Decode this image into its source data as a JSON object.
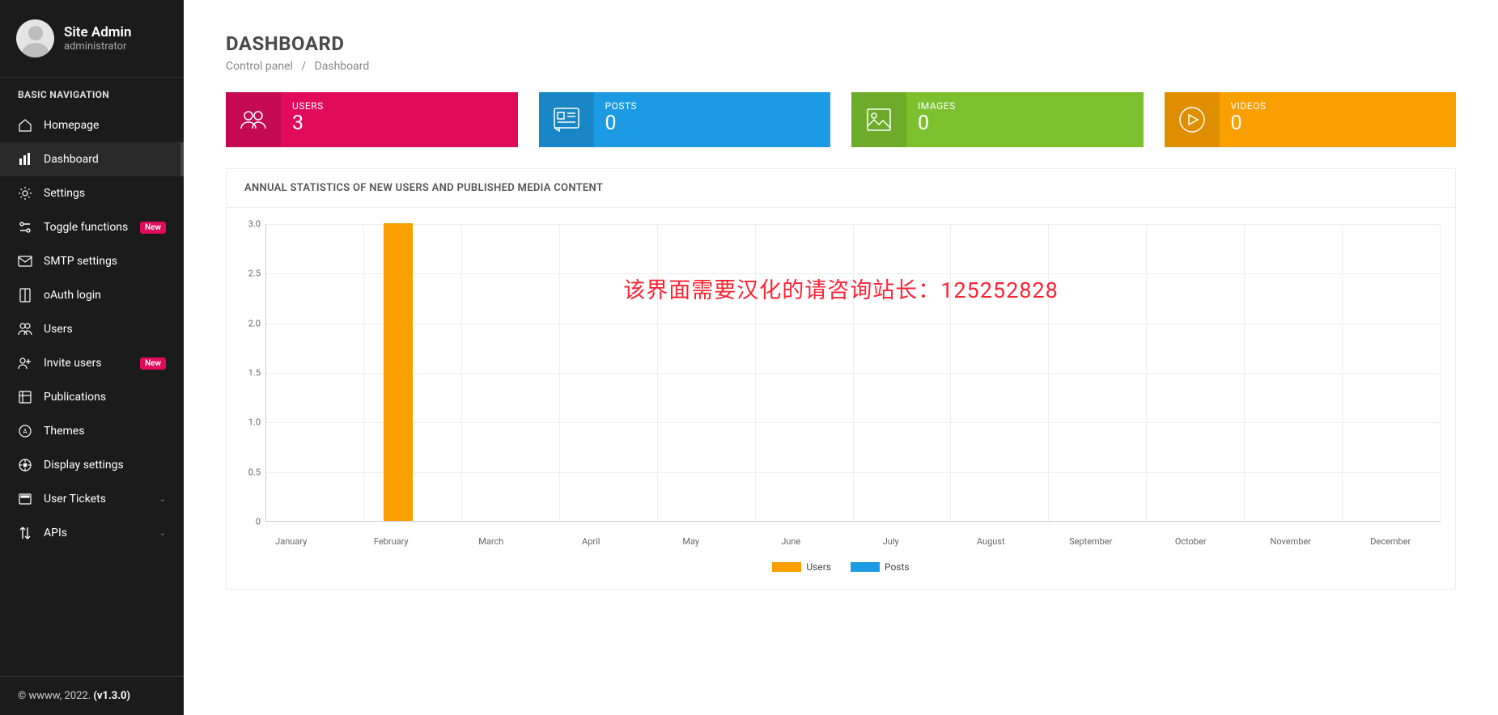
{
  "profile": {
    "name": "Site Admin",
    "role": "administrator"
  },
  "nav": {
    "heading": "BASIC NAVIGATION",
    "items": [
      {
        "label": "Homepage"
      },
      {
        "label": "Dashboard",
        "active": true
      },
      {
        "label": "Settings"
      },
      {
        "label": "Toggle functions",
        "badge": "New"
      },
      {
        "label": "SMTP settings"
      },
      {
        "label": "oAuth login"
      },
      {
        "label": "Users"
      },
      {
        "label": "Invite users",
        "badge": "New"
      },
      {
        "label": "Publications"
      },
      {
        "label": "Themes"
      },
      {
        "label": "Display settings"
      },
      {
        "label": "User Tickets",
        "expandable": true
      },
      {
        "label": "APIs",
        "expandable": true
      }
    ]
  },
  "footer": {
    "copyright": "© wwww, 2022. ",
    "version": "(v1.3.0)"
  },
  "page": {
    "title": "DASHBOARD",
    "crumb1": "Control panel",
    "sep": "/",
    "crumb2": "Dashboard"
  },
  "stats": {
    "users": {
      "label": "USERS",
      "value": "3"
    },
    "posts": {
      "label": "POSTS",
      "value": "0"
    },
    "images": {
      "label": "IMAGES",
      "value": "0"
    },
    "videos": {
      "label": "VIDEOS",
      "value": "0"
    }
  },
  "panel": {
    "title": "ANNUAL STATISTICS OF NEW USERS AND PUBLISHED MEDIA CONTENT"
  },
  "watermark": "该界面需要汉化的请咨询站长：125252828",
  "legend": {
    "users": "Users",
    "posts": "Posts"
  },
  "chart_data": {
    "type": "bar",
    "categories": [
      "January",
      "February",
      "March",
      "April",
      "May",
      "June",
      "July",
      "August",
      "September",
      "October",
      "November",
      "December"
    ],
    "series": [
      {
        "name": "Users",
        "color": "#f99f00",
        "values": [
          0,
          3,
          0,
          0,
          0,
          0,
          0,
          0,
          0,
          0,
          0,
          0
        ]
      },
      {
        "name": "Posts",
        "color": "#1c9be4",
        "values": [
          0,
          0,
          0,
          0,
          0,
          0,
          0,
          0,
          0,
          0,
          0,
          0
        ]
      }
    ],
    "y_ticks": [
      0,
      0.5,
      1.0,
      1.5,
      2.0,
      2.5,
      3.0
    ],
    "ylim": [
      0,
      3.0
    ]
  }
}
